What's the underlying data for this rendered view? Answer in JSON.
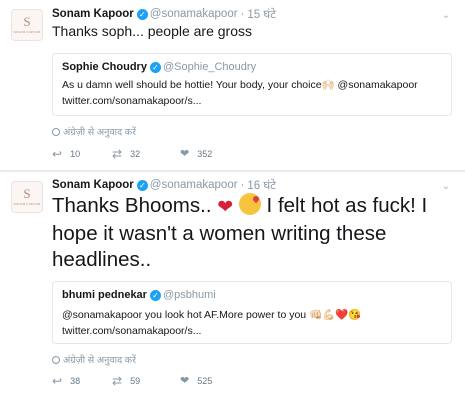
{
  "tweets": [
    {
      "author_name": "Sonam Kapoor",
      "handle": "@sonamakapoor",
      "dot": "·",
      "time": "15 घंटे",
      "avatar": {
        "monogram": "S",
        "caption": "SONAM KAPOOR"
      },
      "text": "Thanks soph... people are gross",
      "quote": {
        "name": "Sophie Choudry",
        "handle": "@Sophie_Choudry",
        "line1": "As u damn well should be hottie! Your body, your choice🙌🏻 @sonamakapoor",
        "line2": "twitter.com/sonamakapoor/s..."
      },
      "translate": "अंग्रेज़ी से अनुवाद करें",
      "replies": "10",
      "retweets": "32",
      "likes": "352"
    },
    {
      "author_name": "Sonam Kapoor",
      "handle": "@sonamakapoor",
      "dot": "·",
      "time": "16 घंटे",
      "avatar": {
        "monogram": "S",
        "caption": "SONAM KAPOOR"
      },
      "text_part1": "Thanks Bhooms..",
      "text_part2": "I felt hot as fuck! I hope it wasn't a women writing these headlines..",
      "quote": {
        "name": "bhumi pednekar",
        "handle": "@psbhumi",
        "line1": "@sonamakapoor you look hot AF.More power to you 👊🏻💪🏻❤️😘",
        "line2": "twitter.com/sonamakapoor/s..."
      },
      "translate": "अंग्रेज़ी से अनुवाद करें",
      "replies": "38",
      "retweets": "59",
      "likes": "525"
    }
  ],
  "icons": {
    "verified": "✓",
    "chevron": "⌄",
    "reply": "↩",
    "retweet": "⇄",
    "like": "❤",
    "heart_emoji": "❤"
  },
  "colors": {
    "link_blue": "#1da1f2",
    "muted": "#8899a6",
    "heart_red": "#d8203a"
  }
}
